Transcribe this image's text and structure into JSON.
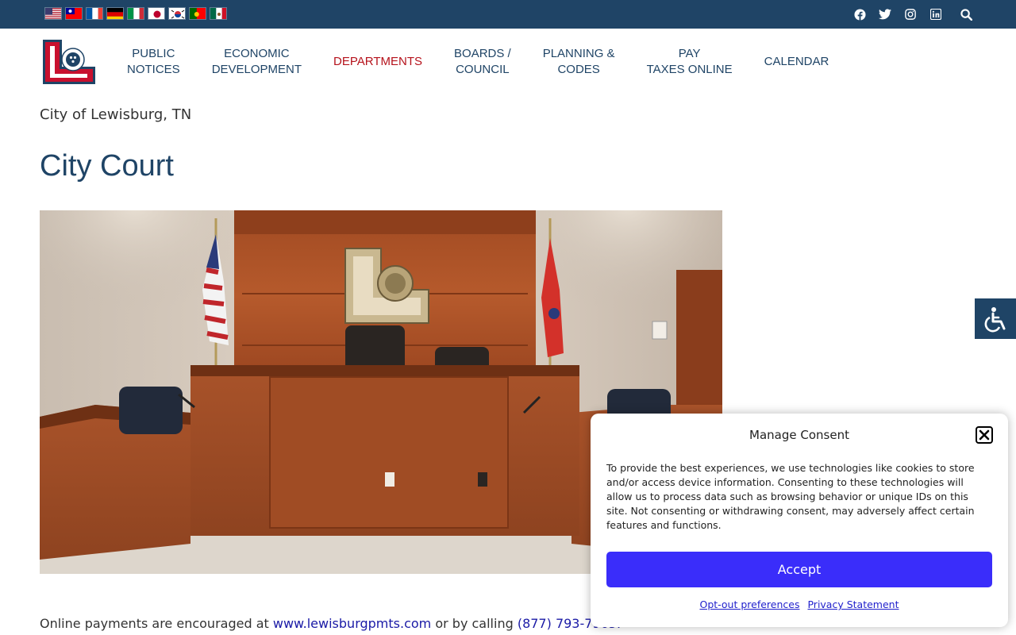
{
  "topbar": {
    "languages": [
      "English",
      "Chinese (Traditional)",
      "French",
      "German",
      "Italian",
      "Japanese",
      "Korean",
      "Portuguese",
      "Spanish"
    ],
    "social_icons": [
      "facebook-icon",
      "twitter-icon",
      "instagram-icon",
      "linkedin-icon",
      "search-icon"
    ]
  },
  "nav": {
    "items": [
      {
        "label": "PUBLIC\nNOTICES"
      },
      {
        "label": "ECONOMIC\nDEVELOPMENT"
      },
      {
        "label": "DEPARTMENTS"
      },
      {
        "label": "BOARDS /\nCOUNCIL"
      },
      {
        "label": "PLANNING &\nCODES"
      },
      {
        "label": "PAY\nTAXES ONLINE"
      },
      {
        "label": "CALENDAR"
      }
    ],
    "active_color": "#b5121b",
    "color": "#1f4466"
  },
  "site_name": "City of Lewisburg, TN",
  "page_title": "City Court",
  "content": {
    "para_prefix": "Online payments are encouraged at ",
    "payment_link": "www.lewisburgpmts.com",
    "para_middle": " or by calling ",
    "phone": "(877) 793-7965."
  },
  "consent": {
    "title": "Manage Consent",
    "text": "To provide the best experiences, we use technologies like cookies to store and/or access device information. Consenting to these technologies will allow us to process data such as browsing behavior or unique IDs on this site. Not consenting or withdrawing consent, may adversely affect certain features and functions.",
    "accept_label": "Accept",
    "optout_label": "Opt-out preferences",
    "privacy_label": "Privacy Statement",
    "accent": "#3a2dfa"
  },
  "colors": {
    "brand_navy": "#1f4466",
    "brand_red": "#b5121b"
  }
}
